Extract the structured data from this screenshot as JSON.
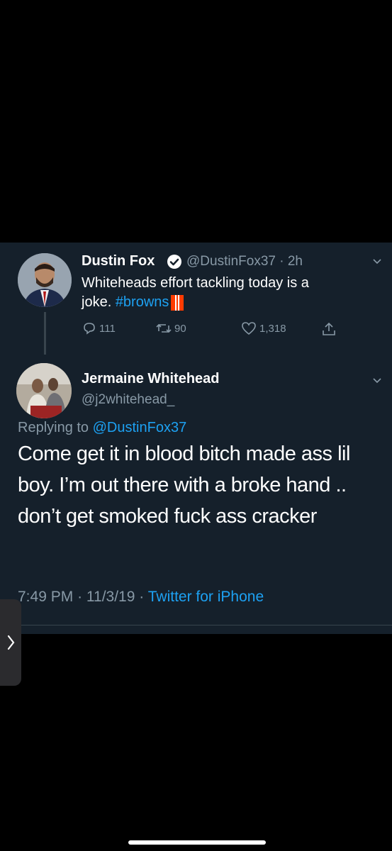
{
  "tweet": {
    "name": "Dustin Fox",
    "handle": "@DustinFox37",
    "separator": "·",
    "time": "2h",
    "text_line1": "Whiteheads effort tackling today is a",
    "text_line2_prefix": "joke. ",
    "hashtag": "#browns",
    "replies": "111",
    "retweets": "90",
    "likes": "1,318"
  },
  "reply": {
    "name": "Jermaine Whitehead",
    "handle": "@j2whitehead_",
    "replying_prefix": "Replying to ",
    "replying_handle": "@DustinFox37",
    "text": "Come get it in blood bitch made ass lil boy. I’m out there with a broke hand .. don’t get smoked fuck ass cracker",
    "time": "7:49 PM",
    "date": "11/3/19",
    "separator": "·",
    "source": "Twitter for iPhone"
  },
  "colors": {
    "background": "#15202b",
    "accent": "#1da1f2",
    "muted": "#8899a6",
    "browns_orange": "#ff3c00"
  },
  "icons": [
    "verified-badge-icon",
    "reply-icon",
    "retweet-icon",
    "like-icon",
    "share-icon",
    "chevron-down-icon",
    "chevron-right-icon"
  ]
}
